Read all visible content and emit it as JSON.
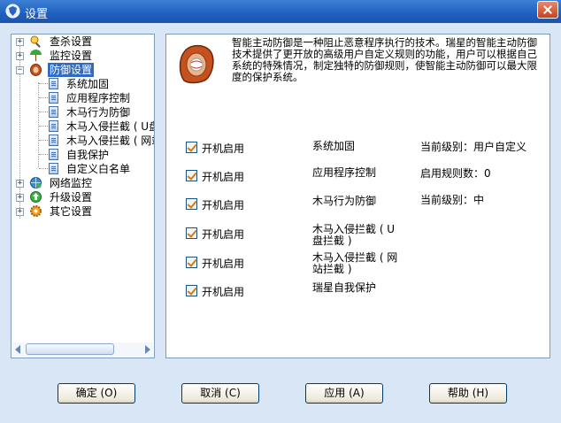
{
  "window": {
    "title": "设置"
  },
  "tree": {
    "items": [
      {
        "label": "查杀设置",
        "icon": "magnifier-person-icon"
      },
      {
        "label": "监控设置",
        "icon": "umbrella-icon"
      },
      {
        "label": "防御设置",
        "icon": "glove-icon",
        "selected": true
      },
      {
        "label": "系统加固",
        "icon": "document-icon"
      },
      {
        "label": "应用程序控制",
        "icon": "document-icon"
      },
      {
        "label": "木马行为防御",
        "icon": "document-icon"
      },
      {
        "label": "木马入侵拦截 ( U盘",
        "icon": "document-icon"
      },
      {
        "label": "木马入侵拦截 ( 网站",
        "icon": "document-icon"
      },
      {
        "label": "自我保护",
        "icon": "document-icon"
      },
      {
        "label": "自定义白名单",
        "icon": "document-icon"
      },
      {
        "label": "网络监控",
        "icon": "globe-network-icon"
      },
      {
        "label": "升级设置",
        "icon": "globe-arrow-icon"
      },
      {
        "label": "其它设置",
        "icon": "gear-icon"
      }
    ]
  },
  "content": {
    "description": "智能主动防御是一种阻止恶意程序执行的技术。瑞星的智能主动防御技术提供了更开放的高级用户自定义规则的功能，用户可以根据自己系统的特殊情况，制定独特的防御规则，使智能主动防御可以最大限度的保护系统。",
    "options": [
      {
        "toggle": "开机启用",
        "checked": true,
        "feature": "系统加固",
        "status": "当前级别：用户自定义"
      },
      {
        "toggle": "开机启用",
        "checked": true,
        "feature": "应用程序控制",
        "status": "启用规则数：0"
      },
      {
        "toggle": "开机启用",
        "checked": true,
        "feature": "木马行为防御",
        "status": "当前级别：中"
      },
      {
        "toggle": "开机启用",
        "checked": true,
        "feature": "木马入侵拦截 ( U盘拦截 )",
        "status": ""
      },
      {
        "toggle": "开机启用",
        "checked": true,
        "feature": "木马入侵拦截 ( 网站拦截 )",
        "status": ""
      },
      {
        "toggle": "开机启用",
        "checked": true,
        "feature": "瑞星自我保护",
        "status": ""
      }
    ]
  },
  "buttons": {
    "ok": "确定 (O)",
    "cancel": "取消 (C)",
    "apply": "应用 (A)",
    "help": "帮助 (H)"
  }
}
